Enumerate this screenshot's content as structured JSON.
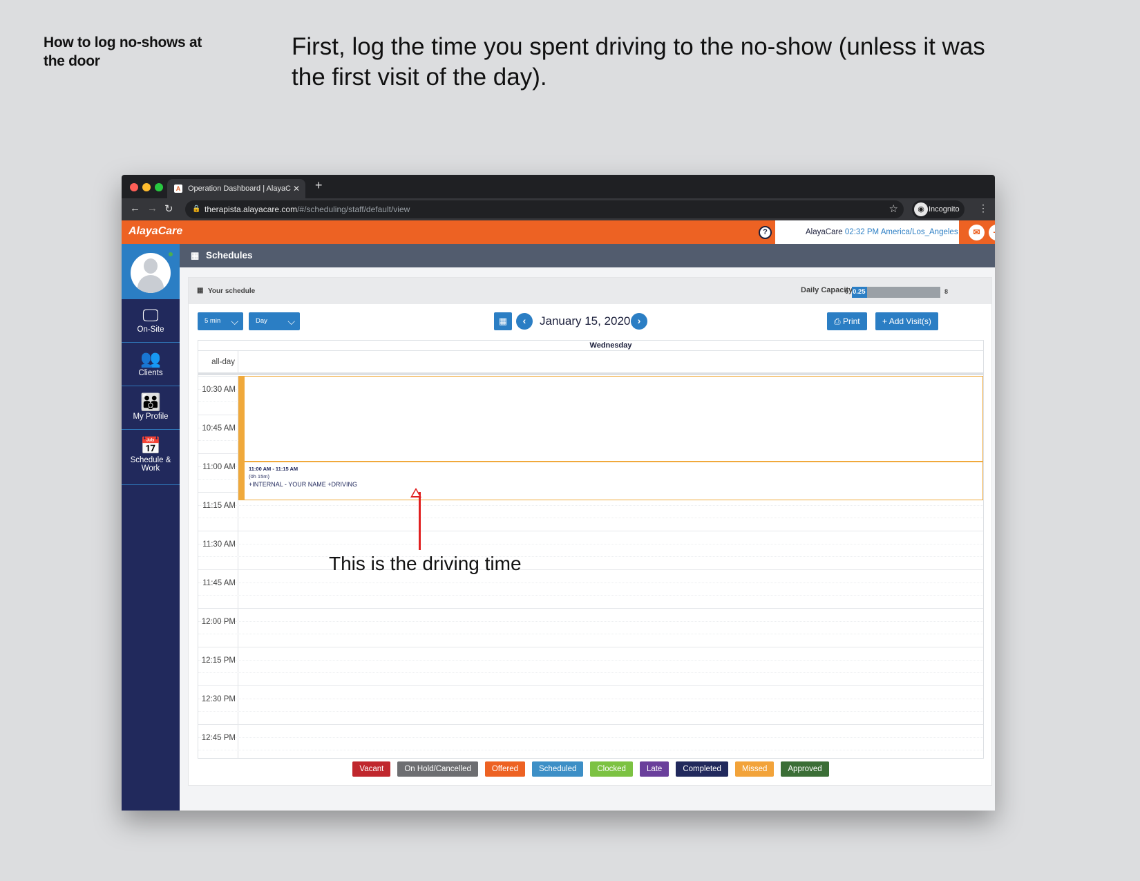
{
  "instructions": {
    "side_title": "How to log no-shows at the door",
    "main_title": "First, log the time you spent driving to the no-show (unless it was the first visit of the day).",
    "annotation": "This is the driving time"
  },
  "browser": {
    "tab_title": "Operation Dashboard | AlayaC",
    "url_host": "therapista.alayacare.com",
    "url_path": "/#/scheduling/staff/default/view",
    "incognito_label": "Incognito"
  },
  "appbar": {
    "logo": "AlayaCare",
    "user": "AlayaCare",
    "time": "02:32 PM",
    "timezone": "America/Los_Angeles"
  },
  "sidebar": {
    "items": [
      {
        "label": "On-Site",
        "icon": "monitor-icon"
      },
      {
        "label": "Clients",
        "icon": "people-icon"
      },
      {
        "label": "My Profile",
        "icon": "team-icon"
      },
      {
        "label": "Schedule & Work",
        "icon": "calendar-icon"
      }
    ]
  },
  "page": {
    "title": "Schedules",
    "panel_title": "Your schedule",
    "capacity_label": "Daily Capacity",
    "capacity_min": "0",
    "capacity_value": "0.25",
    "capacity_max": "8",
    "capacity_fraction": 0.03125
  },
  "toolbar": {
    "interval": "5 min",
    "view": "Day",
    "date": "January 15, 2020",
    "print": "Print",
    "add_visit": "Add Visit(s)"
  },
  "calendar": {
    "day_header": "Wednesday",
    "allday_label": "all-day",
    "time_labels": [
      "10:30 AM",
      "10:45 AM",
      "11:00 AM",
      "11:15 AM",
      "11:30 AM",
      "11:45 AM",
      "12:00 PM",
      "12:15 PM",
      "12:30 PM",
      "12:45 PM"
    ],
    "event": {
      "time": "11:00 AM - 11:15 AM",
      "duration": "(0h 15m)",
      "title": "+INTERNAL - YOUR NAME +DRIVING"
    }
  },
  "legend": [
    {
      "label": "Vacant",
      "color": "#c0272d"
    },
    {
      "label": "On Hold/Cancelled",
      "color": "#6d6e71"
    },
    {
      "label": "Offered",
      "color": "#ed6223"
    },
    {
      "label": "Scheduled",
      "color": "#3d8fc6"
    },
    {
      "label": "Clocked",
      "color": "#7cc242"
    },
    {
      "label": "Late",
      "color": "#6a3f9b"
    },
    {
      "label": "Completed",
      "color": "#21295c"
    },
    {
      "label": "Missed",
      "color": "#f2a33a"
    },
    {
      "label": "Approved",
      "color": "#3b6e36"
    }
  ]
}
